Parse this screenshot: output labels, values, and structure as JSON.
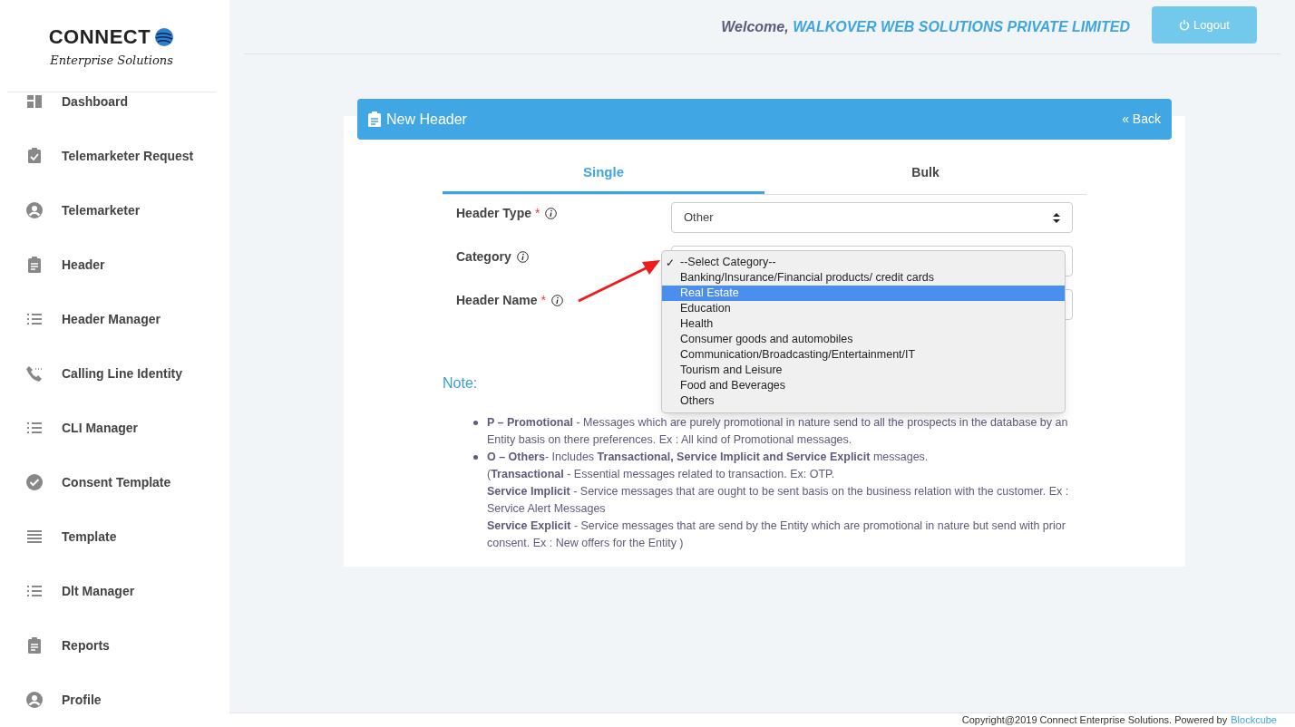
{
  "logo": {
    "title": "CONNECT",
    "subtitle": "Enterprise Solutions"
  },
  "sidebar": {
    "items": [
      {
        "label": "Dashboard",
        "kind": "grid"
      },
      {
        "label": "Telemarketer Request",
        "kind": "check-clipboard"
      },
      {
        "label": "Telemarketer",
        "kind": "person"
      },
      {
        "label": "Header",
        "kind": "clipboard"
      },
      {
        "label": "Header Manager",
        "kind": "list"
      },
      {
        "label": "Calling Line Identity",
        "kind": "phone"
      },
      {
        "label": "CLI Manager",
        "kind": "list"
      },
      {
        "label": "Consent Template",
        "kind": "check-circle"
      },
      {
        "label": "Template",
        "kind": "lines"
      },
      {
        "label": "Dlt Manager",
        "kind": "list"
      },
      {
        "label": "Reports",
        "kind": "clipboard"
      },
      {
        "label": "Profile",
        "kind": "person"
      }
    ]
  },
  "topbar": {
    "welcome": "Welcome,",
    "company": "WALKOVER WEB SOLUTIONS PRIVATE LIMITED",
    "logout": "Logout"
  },
  "card": {
    "title": "New Header",
    "back": "« Back",
    "tabs": [
      {
        "label": "Single",
        "selected": true
      },
      {
        "label": "Bulk",
        "selected": false
      }
    ],
    "fields": [
      {
        "label": "Header Type",
        "required_mark": "*",
        "value": "Other"
      },
      {
        "label": "Category"
      },
      {
        "label": "Header Name",
        "required_mark": "*"
      }
    ],
    "dropdown": {
      "check_mark": "✓",
      "options": [
        {
          "label": "--Select Category--",
          "checked": true,
          "selected": false
        },
        {
          "label": "Banking/Insurance/Financial products/ credit cards",
          "checked": false,
          "selected": false
        },
        {
          "label": "Real Estate",
          "checked": false,
          "selected": true
        },
        {
          "label": "Education",
          "checked": false,
          "selected": false
        },
        {
          "label": "Health",
          "checked": false,
          "selected": false
        },
        {
          "label": "Consumer goods and automobiles",
          "checked": false,
          "selected": false
        },
        {
          "label": "Communication/Broadcasting/Entertainment/IT",
          "checked": false,
          "selected": false
        },
        {
          "label": "Tourism and Leisure",
          "checked": false,
          "selected": false
        },
        {
          "label": "Food and Beverages",
          "checked": false,
          "selected": false
        },
        {
          "label": "Others",
          "checked": false,
          "selected": false
        }
      ]
    },
    "note": {
      "title": "Note:",
      "items": [
        {
          "lines": [
            "**P – Promotional** - Messages which are purely promotional in nature send to all the prospects in the database by an Entity basis on there preferences. Ex : All kind of Promotional messages."
          ]
        },
        {
          "lines": [
            "**O – Others**- Includes **Transactional, Service Implicit and Service Explicit** messages.",
            "(**Transactional** - Essential messages related to transaction. Ex: OTP.",
            "**Service Implicit** - Service messages that are ought to be sent basis on the business relation with the customer. Ex : Service Alert Messages",
            "**Service Explicit** - Service messages that are send by the Entity which are promotional in nature but send with prior consent. Ex : New offers for the Entity )"
          ]
        }
      ]
    }
  },
  "footer": {
    "text": "Copyright@2019 Connect Enterprise Solutions. Powered by",
    "link": "Blockcube"
  }
}
